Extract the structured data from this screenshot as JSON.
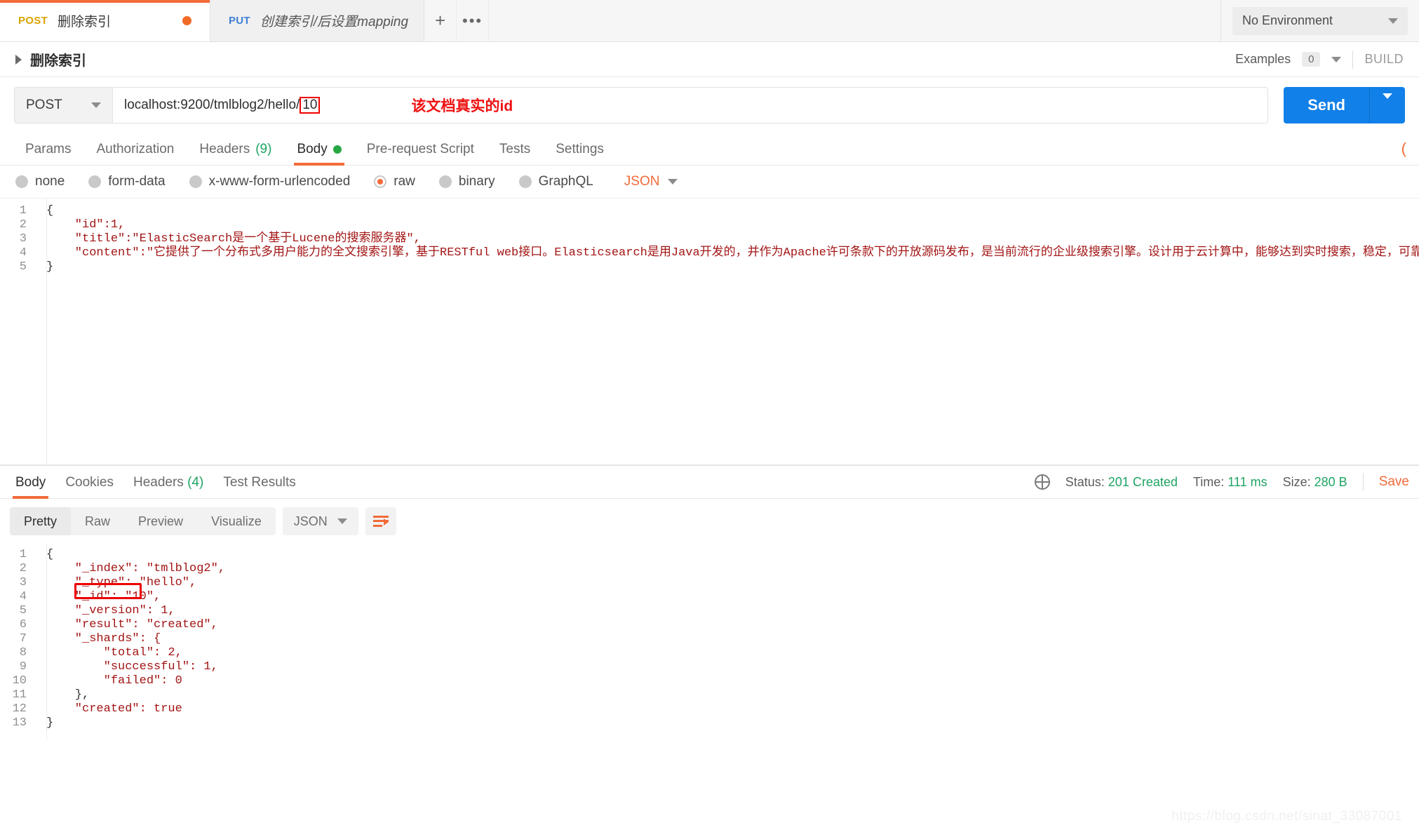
{
  "window": {
    "environment_selector": "No Environment"
  },
  "request_tabs": [
    {
      "method": "POST",
      "name": "删除索引",
      "unsaved": true,
      "active": true
    },
    {
      "method": "PUT",
      "name": "创建索引/后设置mapping",
      "unsaved": false,
      "active": false
    }
  ],
  "tab_actions": {
    "new_tab": "+",
    "more": "•••"
  },
  "request_header": {
    "title": "删除索引",
    "examples_label": "Examples",
    "examples_count": "0",
    "build_label": "BUILD"
  },
  "url_bar": {
    "method": "POST",
    "url_prefix": "localhost:9200/tmlblog2/hello/",
    "url_highlight": "10",
    "annotation": "该文档真实的id",
    "send_label": "Send"
  },
  "request_tabs_row": [
    {
      "label": "Params",
      "badge": "",
      "active": false
    },
    {
      "label": "Authorization",
      "badge": "",
      "active": false
    },
    {
      "label": "Headers",
      "badge": "(9)",
      "active": false
    },
    {
      "label": "Body",
      "badge": "",
      "dot": true,
      "active": true
    },
    {
      "label": "Pre-request Script",
      "badge": "",
      "active": false
    },
    {
      "label": "Tests",
      "badge": "",
      "active": false
    },
    {
      "label": "Settings",
      "badge": "",
      "active": false
    }
  ],
  "body_types": [
    {
      "label": "none",
      "selected": false
    },
    {
      "label": "form-data",
      "selected": false
    },
    {
      "label": "x-www-form-urlencoded",
      "selected": false
    },
    {
      "label": "raw",
      "selected": true
    },
    {
      "label": "binary",
      "selected": false
    },
    {
      "label": "GraphQL",
      "selected": false
    }
  ],
  "body_format": "JSON",
  "request_body_lines": [
    {
      "no": "1",
      "text": "{"
    },
    {
      "no": "2",
      "text": "    \"id\":1,"
    },
    {
      "no": "3",
      "text": "    \"title\":\"ElasticSearch是一个基于Lucene的搜索服务器\","
    },
    {
      "no": "4",
      "text": "    \"content\":\"它提供了一个分布式多用户能力的全文搜索引擎，基于RESTful web接口。Elasticsearch是用Java开发的，并作为Apache许可条款下的开放源码发布，是当前流行的企业级搜索引擎。设计用于云计算中，能够达到实时搜索，稳定，可靠，快速，安装使用方便"
    },
    {
      "no": "5",
      "text": "}"
    }
  ],
  "response_tabs": [
    {
      "label": "Body",
      "badge": "",
      "active": true
    },
    {
      "label": "Cookies",
      "badge": "",
      "active": false
    },
    {
      "label": "Headers",
      "badge": "(4)",
      "active": false
    },
    {
      "label": "Test Results",
      "badge": "",
      "active": false
    }
  ],
  "response_meta": {
    "status_label": "Status:",
    "status_value": "201 Created",
    "time_label": "Time:",
    "time_value": "111 ms",
    "size_label": "Size:",
    "size_value": "280 B",
    "save_label": "Save"
  },
  "response_toolbar": {
    "views": [
      {
        "label": "Pretty",
        "active": true
      },
      {
        "label": "Raw",
        "active": false
      },
      {
        "label": "Preview",
        "active": false
      },
      {
        "label": "Visualize",
        "active": false
      }
    ],
    "format": "JSON",
    "wrap_icon": "word-wrap-icon"
  },
  "response_body_lines": [
    {
      "no": "1",
      "text": "{"
    },
    {
      "no": "2",
      "text": "    \"_index\": \"tmlblog2\","
    },
    {
      "no": "3",
      "text": "    \"_type\": \"hello\","
    },
    {
      "no": "4",
      "text": "    \"_id\": \"10\","
    },
    {
      "no": "5",
      "text": "    \"_version\": 1,"
    },
    {
      "no": "6",
      "text": "    \"result\": \"created\","
    },
    {
      "no": "7",
      "text": "    \"_shards\": {"
    },
    {
      "no": "8",
      "text": "        \"total\": 2,"
    },
    {
      "no": "9",
      "text": "        \"successful\": 1,"
    },
    {
      "no": "10",
      "text": "        \"failed\": 0"
    },
    {
      "no": "11",
      "text": "    },"
    },
    {
      "no": "12",
      "text": "    \"created\": true"
    },
    {
      "no": "13",
      "text": "}"
    }
  ],
  "watermark": "https://blog.csdn.net/sinat_33087001",
  "colors": {
    "accent_orange": "#f26b3a",
    "send_blue": "#1180e8",
    "status_green": "#1fa463",
    "highlight_red": "#ee0000"
  }
}
